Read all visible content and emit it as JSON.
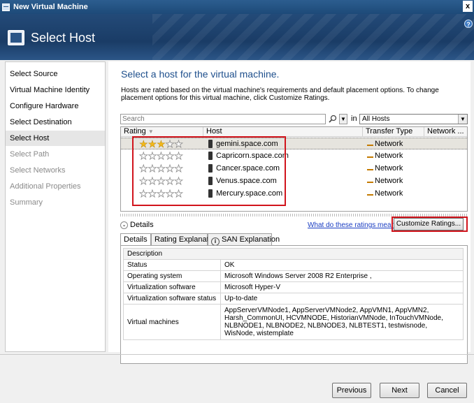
{
  "window": {
    "title": "New Virtual Machine",
    "close_glyph": "x"
  },
  "banner": {
    "title": "Select Host",
    "help_glyph": "?"
  },
  "nav": {
    "items": [
      {
        "label": "Select Source",
        "state": "normal"
      },
      {
        "label": "Virtual Machine Identity",
        "state": "normal"
      },
      {
        "label": "Configure Hardware",
        "state": "normal"
      },
      {
        "label": "Select Destination",
        "state": "normal"
      },
      {
        "label": "Select Host",
        "state": "selected"
      },
      {
        "label": "Select Path",
        "state": "dim"
      },
      {
        "label": "Select Networks",
        "state": "dim"
      },
      {
        "label": "Additional Properties",
        "state": "dim"
      },
      {
        "label": "Summary",
        "state": "dim"
      }
    ]
  },
  "main": {
    "heading": "Select a host for the virtual machine.",
    "description": "Hosts are rated based on the virtual machine's requirements and default placement options. To change placement options for this virtual machine, click Customize Ratings."
  },
  "search": {
    "placeholder": "Search",
    "in_label": "in",
    "scope_value": "All Hosts"
  },
  "grid": {
    "headers": {
      "rating": "Rating",
      "host": "Host",
      "transfer": "Transfer Type",
      "network": "Network ..."
    },
    "rows": [
      {
        "stars": 3,
        "host": "gemini.space.com",
        "transfer": "Network"
      },
      {
        "stars": 0,
        "host": "Capricorn.space.com",
        "transfer": "Network"
      },
      {
        "stars": 0,
        "host": "Cancer.space.com",
        "transfer": "Network"
      },
      {
        "stars": 0,
        "host": "Venus.space.com",
        "transfer": "Network"
      },
      {
        "stars": 0,
        "host": "Mercury.space.com",
        "transfer": "Network"
      }
    ]
  },
  "details": {
    "toggle_label": "Details",
    "link": "What do these ratings mean?",
    "customize_button": "Customize Ratings...",
    "tabs": [
      "Details",
      "Rating Explanation",
      "SAN Explanation"
    ],
    "table": {
      "description_label": "Description",
      "rows": [
        {
          "key": "Status",
          "value": "OK"
        },
        {
          "key": "Operating system",
          "value": "Microsoft Windows Server 2008 R2 Enterprise ,"
        },
        {
          "key": "Virtualization software",
          "value": "Microsoft Hyper-V"
        },
        {
          "key": "Virtualization software status",
          "value": "Up-to-date"
        },
        {
          "key": "Virtual machines",
          "value": "AppServerVMNode1, AppServerVMNode2, AppVMN1, AppVMN2, Harsh_CommonUI, HCVMNODE, HistorianVMNode, InTouchVMNode, NLBNODE1, NLBNODE2, NLBNODE3, NLBTEST1, testwisnode, WisNode, wistemplate"
        }
      ]
    }
  },
  "footer": {
    "previous": "Previous",
    "next": "Next",
    "cancel": "Cancel"
  },
  "colors": {
    "accent_heading": "#1e4f8c",
    "highlight_box": "#d1141c",
    "star_on": "#f2b81a"
  }
}
